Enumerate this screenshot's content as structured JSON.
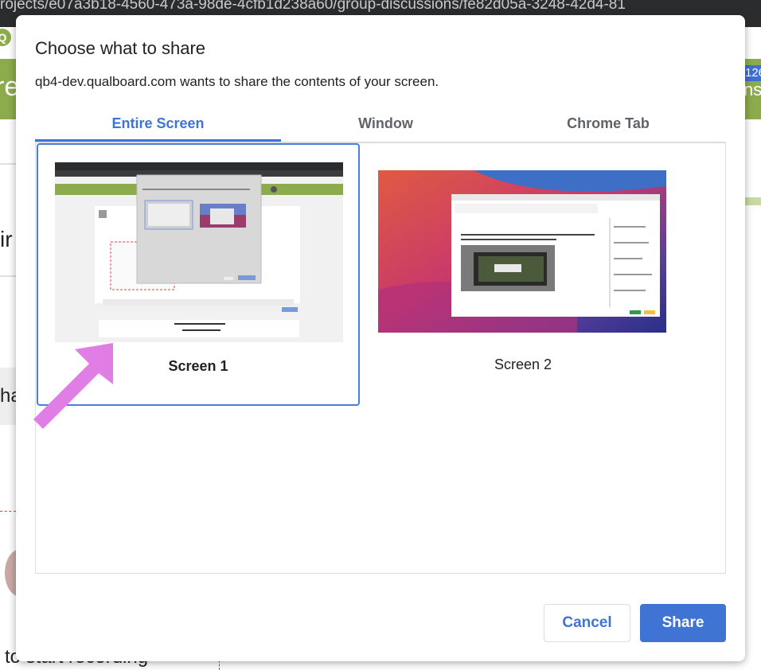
{
  "background": {
    "url_fragment": "rojects/e07a3b18-4560-473a-98de-4cfb1d238a60/group-discussions/fe82d05a-3248-42d4-81",
    "left_header_text": "re",
    "left_texts": [
      "ir",
      "ha"
    ],
    "right_badge": "126",
    "right_header_text": "ns",
    "bottom_text": "to start recording"
  },
  "dialog": {
    "title": "Choose what to share",
    "subtitle": "qb4-dev.qualboard.com wants to share the contents of your screen.",
    "tabs": [
      {
        "label": "Entire Screen",
        "active": true
      },
      {
        "label": "Window",
        "active": false
      },
      {
        "label": "Chrome Tab",
        "active": false
      }
    ],
    "screens": [
      {
        "label": "Screen 1",
        "selected": true
      },
      {
        "label": "Screen 2",
        "selected": false
      }
    ],
    "cancel_label": "Cancel",
    "share_label": "Share"
  },
  "colors": {
    "accent": "#3f74d4",
    "header_green": "#8cab4c",
    "annotation_arrow": "#e07ee6"
  }
}
